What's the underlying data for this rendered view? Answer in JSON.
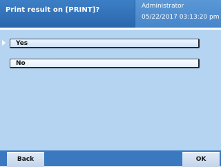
{
  "header": {
    "title": "Print result on [PRINT]?",
    "user": "Administrator",
    "datetime": "05/22/2017 03:13:20 pm"
  },
  "options": [
    {
      "label": "Yes",
      "selected": true
    },
    {
      "label": "No",
      "selected": false
    }
  ],
  "footer": {
    "back_label": "Back",
    "ok_label": "OK"
  },
  "colors": {
    "header_blue": "#2a66ad",
    "content_bg": "#b4d4f2",
    "footer_blue": "#3a78c0"
  }
}
